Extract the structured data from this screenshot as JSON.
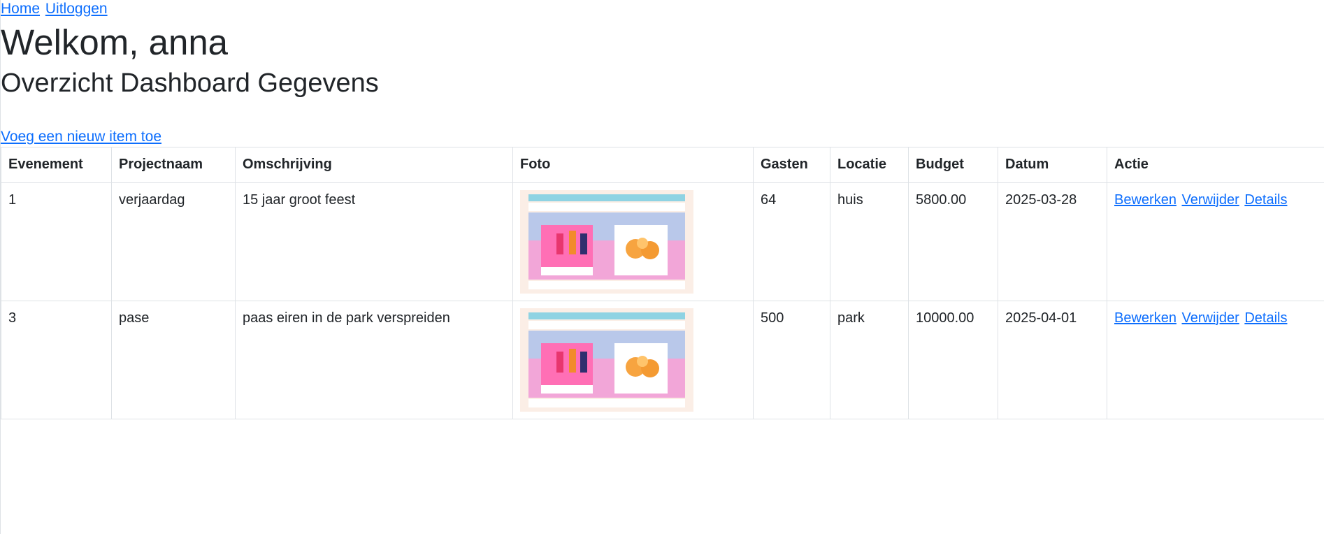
{
  "nav": {
    "home": "Home",
    "logout": "Uitloggen"
  },
  "welcome": "Welkom, anna",
  "subtitle": "Overzicht Dashboard Gegevens",
  "add_item": "Voeg een nieuw item toe",
  "table": {
    "headers": [
      "Evenement",
      "Projectnaam",
      "Omschrijving",
      "Foto",
      "Gasten",
      "Locatie",
      "Budget",
      "Datum",
      "Actie"
    ],
    "actions": {
      "edit": "Bewerken",
      "delete": "Verwijder",
      "details": "Details"
    },
    "rows": [
      {
        "evenement": "1",
        "projectnaam": "verjaardag",
        "omschrijving": "15 jaar groot feest",
        "gasten": "64",
        "locatie": "huis",
        "budget": "5800.00",
        "datum": "2025-03-28"
      },
      {
        "evenement": "3",
        "projectnaam": "pase",
        "omschrijving": "paas eiren in de park verspreiden",
        "gasten": "500",
        "locatie": "park",
        "budget": "10000.00",
        "datum": "2025-04-01"
      }
    ]
  },
  "colors": {
    "link": "#0d6efd",
    "border": "#dee2e6",
    "text": "#212529"
  }
}
